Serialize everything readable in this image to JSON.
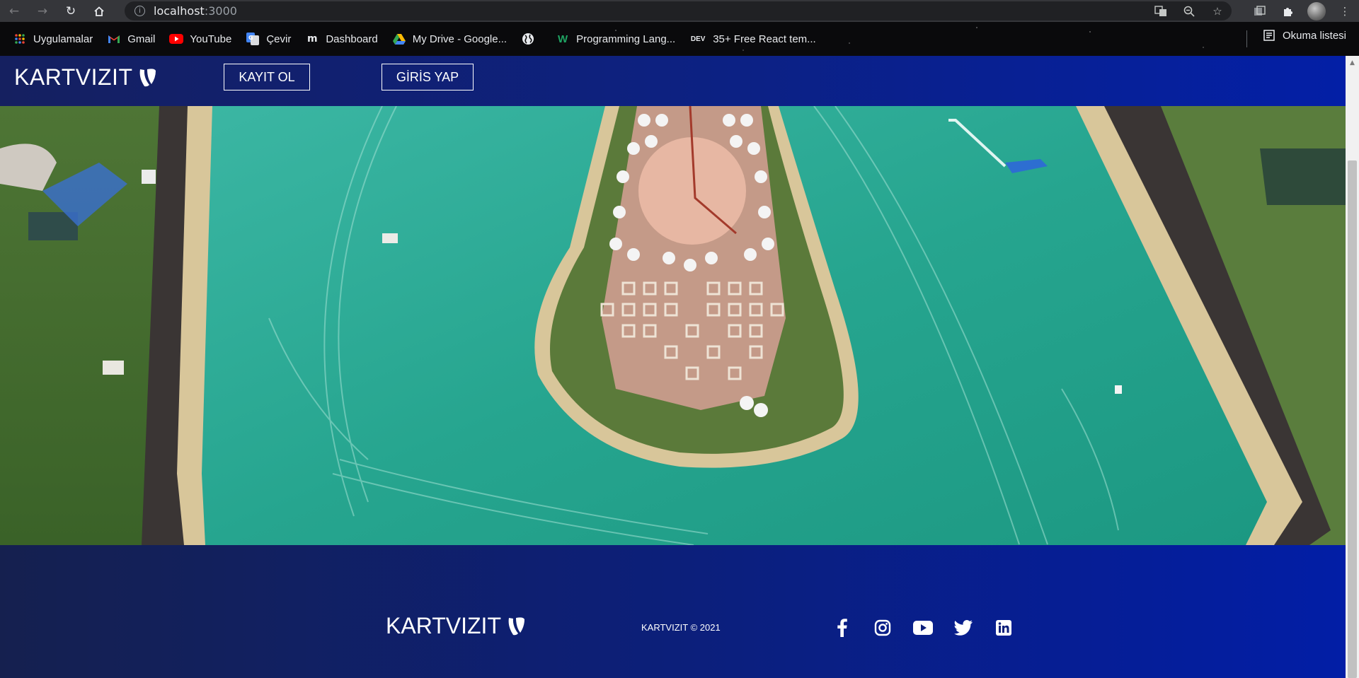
{
  "browser": {
    "url_host": "localhost",
    "url_port": ":3000",
    "bookmarks": [
      {
        "label": "Uygulamalar",
        "icon": "apps-grid-icon"
      },
      {
        "label": "Gmail",
        "icon": "gmail-icon"
      },
      {
        "label": "YouTube",
        "icon": "youtube-icon"
      },
      {
        "label": "Çevir",
        "icon": "translate-icon"
      },
      {
        "label": "Dashboard",
        "icon": "dashboard-m-icon"
      },
      {
        "label": "My Drive - Google...",
        "icon": "google-drive-icon"
      },
      {
        "label": "",
        "icon": "globe-icon"
      },
      {
        "label": "Programming Lang...",
        "icon": "w-logo-icon"
      },
      {
        "label": "35+ Free React tem...",
        "icon": "dev-icon"
      }
    ],
    "dev_icon_text": "DEV",
    "reading_list": "Okuma listesi"
  },
  "navbar": {
    "logo": "KARTVIZIT",
    "register_button": "KAYIT OL",
    "login_button": "GİRİS YAP"
  },
  "hero": {
    "image": "aerial-lake-photo"
  },
  "footer": {
    "logo": "KARTVIZIT",
    "copyright": "KARTVIZIT © 2021",
    "socials": [
      "facebook-icon",
      "instagram-icon",
      "youtube-icon",
      "twitter-icon",
      "linkedin-icon"
    ]
  },
  "colors": {
    "navbar_start": "#152060",
    "navbar_end": "#031fa6",
    "water": "#2aa894"
  }
}
